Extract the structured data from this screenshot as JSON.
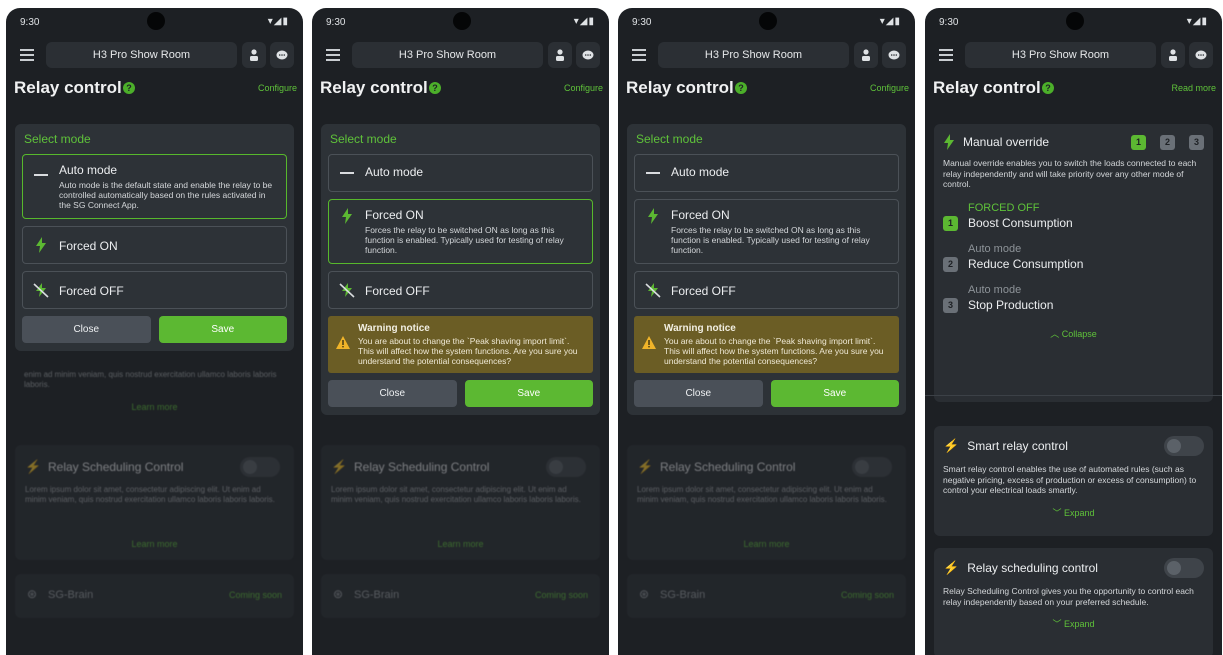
{
  "status": {
    "time": "9:30"
  },
  "app": {
    "room_title": "H3 Pro Show Room"
  },
  "page": {
    "title": "Relay control",
    "configure": "Configure",
    "read_more": "Read more"
  },
  "modal": {
    "title": "Select mode",
    "auto_label": "Auto mode",
    "auto_desc": "Auto mode is the default state and enable the relay to be controlled automatically based on the rules activated in the SG Connect App.",
    "on_label": "Forced ON",
    "on_desc": "Forces the relay to be switched ON as long as this function is enabled. Typically used for testing of relay function.",
    "off_label": "Forced OFF",
    "close": "Close",
    "save": "Save"
  },
  "warning": {
    "title": "Warning notice",
    "text": "You are about to change the `Peak shaving import limit`. This will affect how the system functions. Are you sure you understand the potential consequences?"
  },
  "background": {
    "lorem_tail": "enim ad minim veniam, quis nostrud exercitation ullamco laboris laboris laboris.",
    "learn_more": "Learn more",
    "scheduling_title": "Relay Scheduling Control",
    "scheduling_text": "Lorem ipsum dolor sit amet, consectetur adipiscing elit. Ut enim ad minim veniam, quis nostrud exercitation ullamco laboris laboris laboris.",
    "brain": "SG-Brain",
    "coming_soon": "Coming soon"
  },
  "manual": {
    "title": "Manual override",
    "badges": [
      "1",
      "2",
      "3"
    ],
    "desc": "Manual override enables you to switch the loads connected to each relay independently and will take priority over any other mode of control.",
    "relays": [
      {
        "num": "1",
        "state": "FORCED OFF",
        "name": "Boost Consumption"
      },
      {
        "num": "2",
        "state": "Auto mode",
        "name": "Reduce Consumption"
      },
      {
        "num": "3",
        "state": "Auto mode",
        "name": "Stop Production"
      }
    ],
    "collapse": "Collapse"
  },
  "smart": {
    "title": "Smart relay control",
    "desc": "Smart relay control enables the use of automated rules (such as negative pricing, excess of production or excess of consumption) to control your electrical loads smartly.",
    "expand": "Expand"
  },
  "scheduling": {
    "title": "Relay scheduling control",
    "desc": "Relay Scheduling Control gives you the opportunity to control each relay independently based on your preferred schedule.",
    "expand": "Expand"
  },
  "colors": {
    "accent": "#5cb832",
    "background": "#1d2024",
    "warning": "#6b5d25"
  }
}
